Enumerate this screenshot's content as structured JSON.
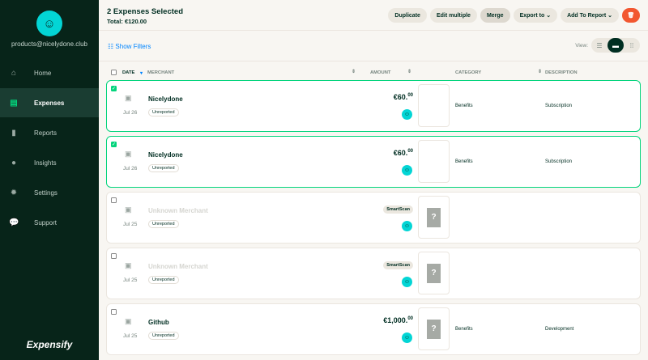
{
  "sidebar": {
    "email": "products@nicelydone.club",
    "logo": "Expensify",
    "items": [
      {
        "label": "Home",
        "icon": "home-icon",
        "glyph": "⌂"
      },
      {
        "label": "Expenses",
        "icon": "expenses-icon",
        "glyph": "▤",
        "active": true
      },
      {
        "label": "Reports",
        "icon": "reports-icon",
        "glyph": "▮"
      },
      {
        "label": "Insights",
        "icon": "lightbulb-icon",
        "glyph": "●"
      },
      {
        "label": "Settings",
        "icon": "gear-icon",
        "glyph": "✹"
      },
      {
        "label": "Support",
        "icon": "chat-icon",
        "glyph": "💬"
      }
    ]
  },
  "header": {
    "title": "2 Expenses Selected",
    "total": "Total: €120.00"
  },
  "toolbar": {
    "duplicate": "Duplicate",
    "edit_multiple": "Edit multiple",
    "merge": "Merge",
    "export_to": "Export to ⌄",
    "add_to_report": "Add To Report ⌄"
  },
  "filters": {
    "label": "Show Filters"
  },
  "view": {
    "label": "View:"
  },
  "table": {
    "columns": {
      "date": "DATE",
      "merchant": "MERCHANT",
      "amount": "AMOUNT",
      "category": "CATEGORY",
      "description": "DESCRIPTION"
    },
    "rows": [
      {
        "selected": true,
        "date": "Jul 26",
        "merchant": "Nicelydone",
        "status": "Unreported",
        "amount": "€60.",
        "cents": "00",
        "receipt": false,
        "category": "Benefits",
        "description": "Subscription"
      },
      {
        "selected": true,
        "date": "Jul 26",
        "merchant": "Nicelydone",
        "status": "Unreported",
        "amount": "€60.",
        "cents": "00",
        "receipt": false,
        "category": "Benefits",
        "description": "Subscription"
      },
      {
        "selected": false,
        "date": "Jul 25",
        "merchant": "Unknown Merchant",
        "status": "Unreported",
        "smartscan": "SmartScan",
        "receipt": true,
        "category": "",
        "description": ""
      },
      {
        "selected": false,
        "date": "Jul 25",
        "merchant": "Unknown Merchant",
        "status": "Unreported",
        "smartscan": "SmartScan",
        "receipt": true,
        "category": "",
        "description": ""
      },
      {
        "selected": false,
        "date": "Jul 25",
        "merchant": "Github",
        "status": "Unreported",
        "amount": "€1,000.",
        "cents": "00",
        "receipt": true,
        "category": "Benefits",
        "description": "Development"
      }
    ]
  }
}
